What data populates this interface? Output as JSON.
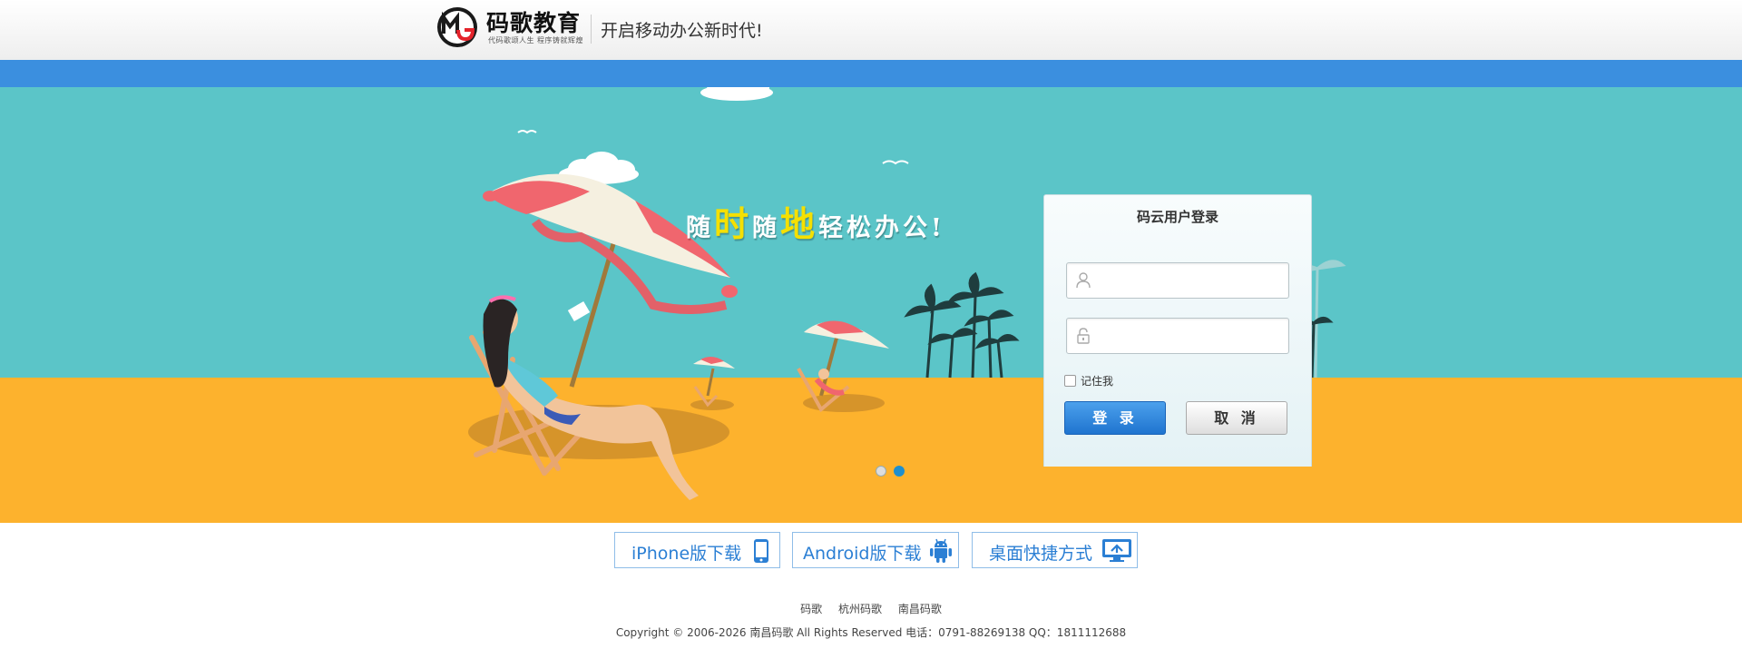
{
  "header": {
    "brand_name": "码歌教育",
    "brand_sub": "代码歌颂人生   程序铸就辉煌",
    "slogan": "开启移动办公新时代!"
  },
  "banner": {
    "slogan_parts": [
      "随",
      "时",
      "随",
      "地",
      "轻松办公!"
    ],
    "slides": 2,
    "active_slide": 2
  },
  "login": {
    "title": "码云用户登录",
    "username_placeholder": "",
    "password_placeholder": "",
    "remember_label": "记住我",
    "login_button": "登 录",
    "cancel_button": "取 消"
  },
  "downloads": {
    "iphone": "iPhone版下载",
    "android": "Android版下载",
    "desktop": "桌面快捷方式"
  },
  "footer": {
    "links": [
      "码歌",
      "杭州码歌",
      "南昌码歌"
    ],
    "copyright": "Copyright © 2006-2026 南昌码歌 All Rights Reserved 电话：0791-88269138 QQ：1811112688"
  },
  "colors": {
    "blue_band": "#3b8fdf",
    "sky": "#5bc5c8",
    "sand": "#fdb22d",
    "accent": "#2b7fd4"
  },
  "icons": [
    "logo-mark",
    "user-icon",
    "lock-icon",
    "phone-icon",
    "android-icon",
    "desktop-icon"
  ]
}
